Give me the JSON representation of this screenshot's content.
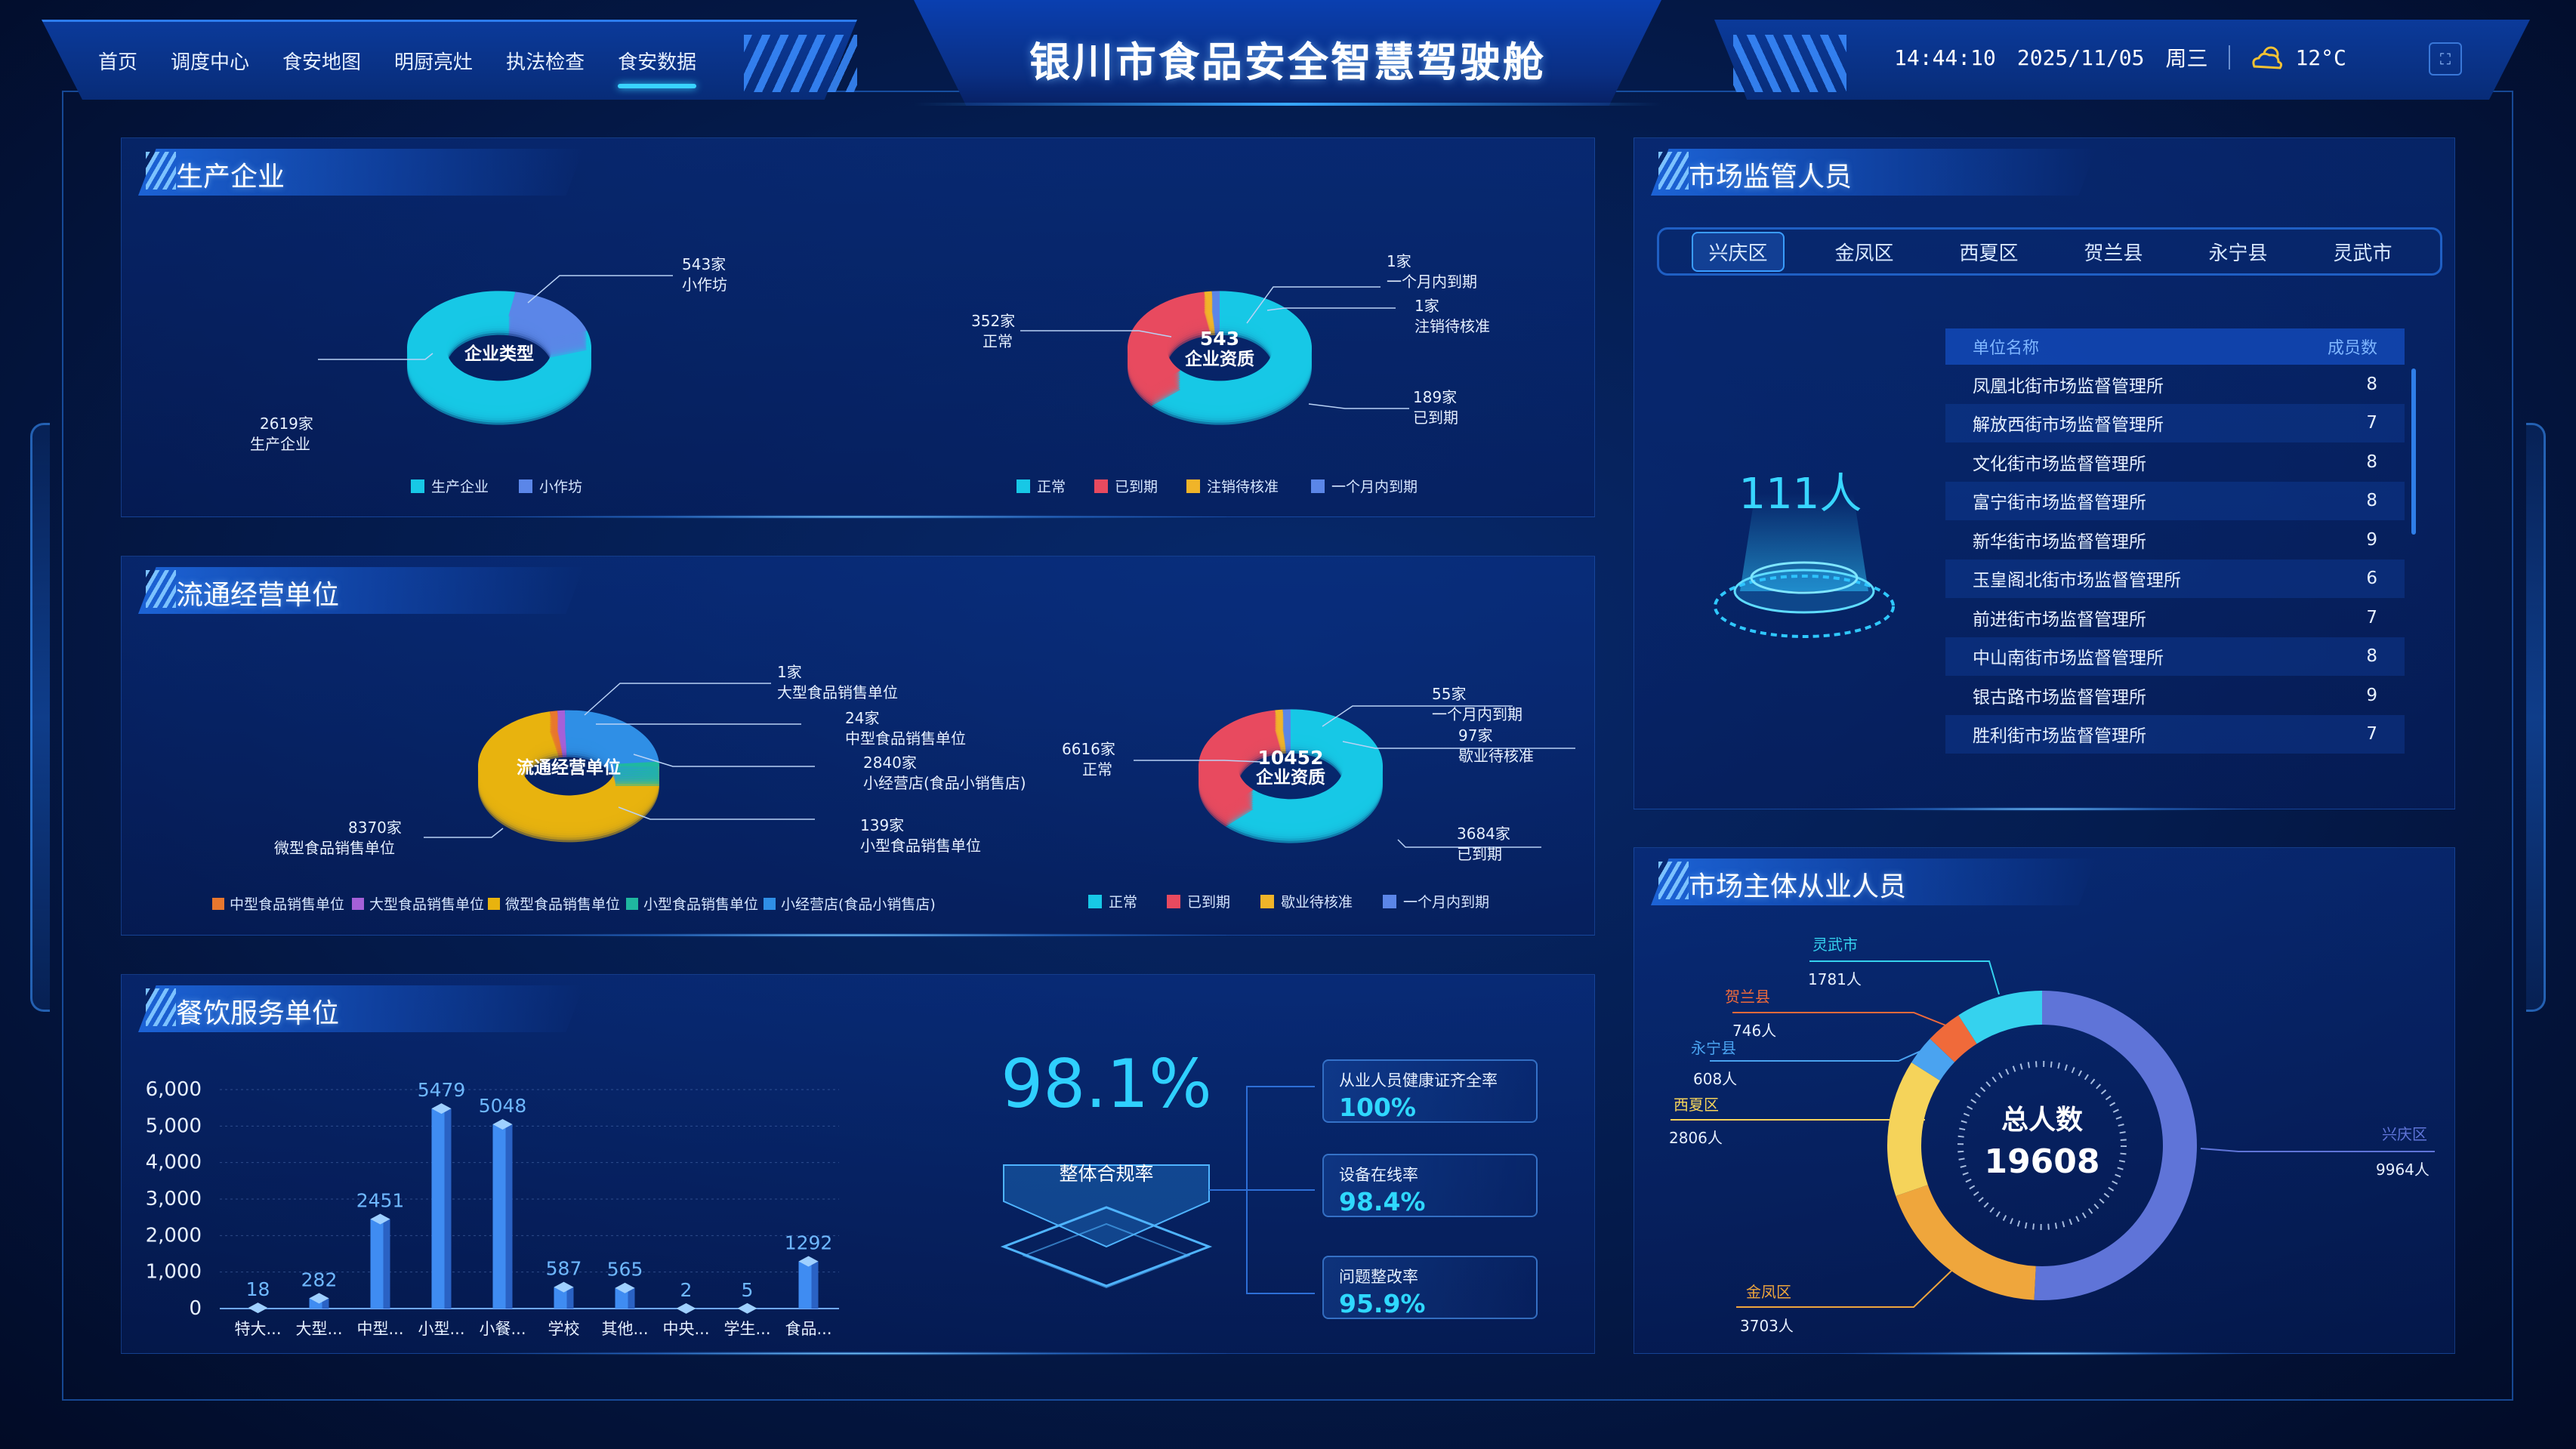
{
  "header": {
    "title": "银川市食品安全智慧驾驶舱",
    "nav": [
      "首页",
      "调度中心",
      "食安地图",
      "明厨亮灶",
      "执法检查",
      "食安数据"
    ],
    "active_nav": "食安数据",
    "time": "14:44:10",
    "date": "2025/11/05",
    "weekday": "周三",
    "temperature": "12°C",
    "weather_icon": "cloud-sun-icon",
    "fullscreen_icon": "fullscreen-icon"
  },
  "panels": {
    "production": {
      "title": "生产企业",
      "type_donut": {
        "center": "企业类型",
        "labels": [
          "543家",
          "小作坊",
          "2619家",
          "生产企业"
        ],
        "legend": [
          "生产企业",
          "小作坊"
        ]
      },
      "status_donut": {
        "center_value": "543",
        "center_label": "企业资质",
        "labels": [
          "1家",
          "一个月内到期",
          "1家",
          "注销待核准",
          "352家",
          "正常",
          "189家",
          "已到期"
        ],
        "legend": [
          "正常",
          "已到期",
          "注销待核准",
          "一个月内到期"
        ]
      }
    },
    "circulation": {
      "title": "流通经营单位",
      "type_donut": {
        "center": "流通经营单位",
        "labels": [
          "1家",
          "大型食品销售单位",
          "24家",
          "中型食品销售单位",
          "2840家",
          "小经营店(食品小销售店)",
          "139家",
          "小型食品销售单位",
          "8370家",
          "微型食品销售单位"
        ],
        "legend": [
          "中型食品销售单位",
          "大型食品销售单位",
          "微型食品销售单位",
          "小型食品销售单位",
          "小经营店(食品小销售店)"
        ]
      },
      "status_donut": {
        "center_value": "10452",
        "center_label": "企业资质",
        "labels": [
          "55家",
          "一个月内到期",
          "97家",
          "歇业待核准",
          "6616家",
          "正常",
          "3684家",
          "已到期"
        ],
        "legend": [
          "正常",
          "已到期",
          "歇业待核准",
          "一个月内到期"
        ]
      }
    },
    "catering": {
      "title": "餐饮服务单位",
      "compliance_value": "98.1%",
      "compliance_label": "整体合规率",
      "metrics": [
        {
          "label": "从业人员健康证齐全率",
          "value": "100%"
        },
        {
          "label": "设备在线率",
          "value": "98.4%"
        },
        {
          "label": "问题整改率",
          "value": "95.9%"
        }
      ]
    },
    "regulators": {
      "title": "市场监管人员",
      "count": "111人",
      "tabs": [
        "兴庆区",
        "金凤区",
        "西夏区",
        "贺兰县",
        "永宁县",
        "灵武市"
      ],
      "active_tab": "兴庆区",
      "table_headers": [
        "单位名称",
        "成员数"
      ],
      "rows": [
        [
          "凤凰北街市场监督管理所",
          "8"
        ],
        [
          "解放西街市场监督管理所",
          "7"
        ],
        [
          "文化街市场监督管理所",
          "8"
        ],
        [
          "富宁街市场监督管理所",
          "8"
        ],
        [
          "新华街市场监督管理所",
          "9"
        ],
        [
          "玉皇阁北街市场监督管理所",
          "6"
        ],
        [
          "前进街市场监督管理所",
          "7"
        ],
        [
          "中山南街市场监督管理所",
          "8"
        ],
        [
          "银古路市场监督管理所",
          "9"
        ],
        [
          "胜利街市场监督管理所",
          "7"
        ]
      ]
    },
    "practitioners": {
      "title": "市场主体从业人员",
      "center_label": "总人数",
      "center_value": "19608",
      "labels": [
        {
          "region": "灵武市",
          "value": "1781人"
        },
        {
          "region": "贺兰县",
          "value": "746人"
        },
        {
          "region": "永宁县",
          "value": "608人"
        },
        {
          "region": "西夏区",
          "value": "2806人"
        },
        {
          "region": "金凤区",
          "value": "3703人"
        },
        {
          "region": "兴庆区",
          "value": "9964人"
        }
      ]
    }
  },
  "chart_data": [
    {
      "type": "pie",
      "title": "企业类型",
      "categories": [
        "生产企业",
        "小作坊"
      ],
      "values": [
        2619,
        543
      ],
      "colors": [
        "#17c8e6",
        "#5b86e8"
      ]
    },
    {
      "type": "pie",
      "title": "企业资质",
      "categories": [
        "正常",
        "已到期",
        "注销待核准",
        "一个月内到期"
      ],
      "values": [
        352,
        189,
        1,
        1
      ],
      "colors": [
        "#17c8e6",
        "#e84a5f",
        "#f0b429",
        "#5b86e8"
      ]
    },
    {
      "type": "pie",
      "title": "流通经营单位",
      "categories": [
        "微型食品销售单位",
        "中型食品销售单位",
        "大型食品销售单位",
        "小经营店(食品小销售店)",
        "小型食品销售单位"
      ],
      "values": [
        8370,
        24,
        1,
        2840,
        139
      ],
      "colors": [
        "#e8b30e",
        "#e8772e",
        "#a560d8",
        "#2f8fe6",
        "#1fb8a0"
      ]
    },
    {
      "type": "pie",
      "title": "企业资质",
      "categories": [
        "正常",
        "已到期",
        "歇业待核准",
        "一个月内到期"
      ],
      "values": [
        6616,
        3684,
        97,
        55
      ],
      "colors": [
        "#17c8e6",
        "#e84a5f",
        "#f0b429",
        "#5b86e8"
      ]
    },
    {
      "type": "bar",
      "categories": [
        "特大...",
        "大型...",
        "中型...",
        "小型...",
        "小餐...",
        "学校",
        "其他...",
        "中央...",
        "学生...",
        "食品..."
      ],
      "values": [
        18,
        282,
        2451,
        5479,
        5048,
        587,
        565,
        2,
        5,
        1292
      ],
      "ylim": [
        0,
        6000
      ],
      "yticks": [
        "6,000",
        "5,000",
        "4,000",
        "3,000",
        "2,000",
        "1,000",
        "0"
      ],
      "bar_color": "#3f8cf2"
    },
    {
      "type": "pie",
      "title": "总人数",
      "categories": [
        "兴庆区",
        "金凤区",
        "西夏区",
        "永宁县",
        "贺兰县",
        "灵武市"
      ],
      "values": [
        9964,
        3703,
        2806,
        608,
        746,
        1781
      ],
      "colors": [
        "#5f74d8",
        "#efa63c",
        "#f5d35a",
        "#4aa3f0",
        "#f06a3a",
        "#35d2ee"
      ]
    }
  ]
}
